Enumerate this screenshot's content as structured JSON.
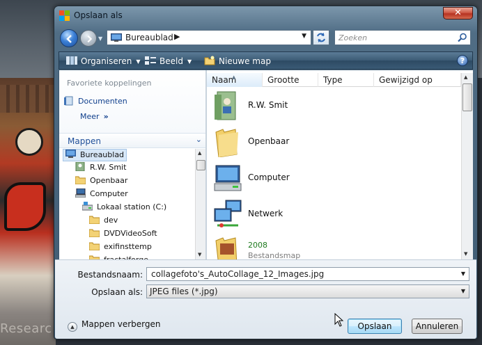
{
  "background": {
    "watermark_text": "Researc"
  },
  "window": {
    "title": "Opslaan als",
    "close_label": "✕"
  },
  "address": {
    "location": "Bureaublad",
    "search_placeholder": "Zoeken"
  },
  "toolbar": {
    "organize_label": "Organiseren",
    "view_label": "Beeld",
    "new_folder_label": "Nieuwe map",
    "help_label": "?"
  },
  "favorites": {
    "header": "Favoriete koppelingen",
    "items": [
      {
        "label": "Documenten"
      }
    ],
    "more_label": "Meer",
    "more_glyph": "»"
  },
  "folders": {
    "header": "Mappen",
    "tree": [
      {
        "label": "Bureaublad",
        "icon": "desktop-icon",
        "selected": true
      },
      {
        "label": "R.W. Smit",
        "icon": "user-folder-icon"
      },
      {
        "label": "Openbaar",
        "icon": "folder-icon"
      },
      {
        "label": "Computer",
        "icon": "computer-icon"
      },
      {
        "label": "Lokaal station (C:)",
        "icon": "drive-icon"
      },
      {
        "label": "dev",
        "icon": "folder-icon"
      },
      {
        "label": "DVDVideoSoft",
        "icon": "folder-icon"
      },
      {
        "label": "exifinsttemp",
        "icon": "folder-icon"
      },
      {
        "label": "fractalforge",
        "icon": "folder-icon"
      }
    ]
  },
  "columns": [
    "Naam",
    "Grootte",
    "Type",
    "Gewijzigd op"
  ],
  "files": [
    {
      "name": "R.W. Smit",
      "icon": "user-folder-icon"
    },
    {
      "name": "Openbaar",
      "icon": "folder-icon"
    },
    {
      "name": "Computer",
      "icon": "computer-icon"
    },
    {
      "name": "Netwerk",
      "icon": "network-icon"
    },
    {
      "name": "2008",
      "sub": "Bestandsmap",
      "icon": "folder-icon"
    }
  ],
  "form": {
    "filename_label": "Bestandsnaam:",
    "filename_value": "collagefoto's_AutoCollage_12_Images.jpg",
    "saveas_label": "Opslaan als:",
    "saveas_value": "JPEG files (*.jpg)",
    "hide_folders_label": "Mappen verbergen",
    "save_label": "Opslaan",
    "cancel_label": "Annuleren"
  },
  "colors": {
    "accent": "#1f4f99",
    "titlebar": "#506d85",
    "close": "#c8462f"
  }
}
